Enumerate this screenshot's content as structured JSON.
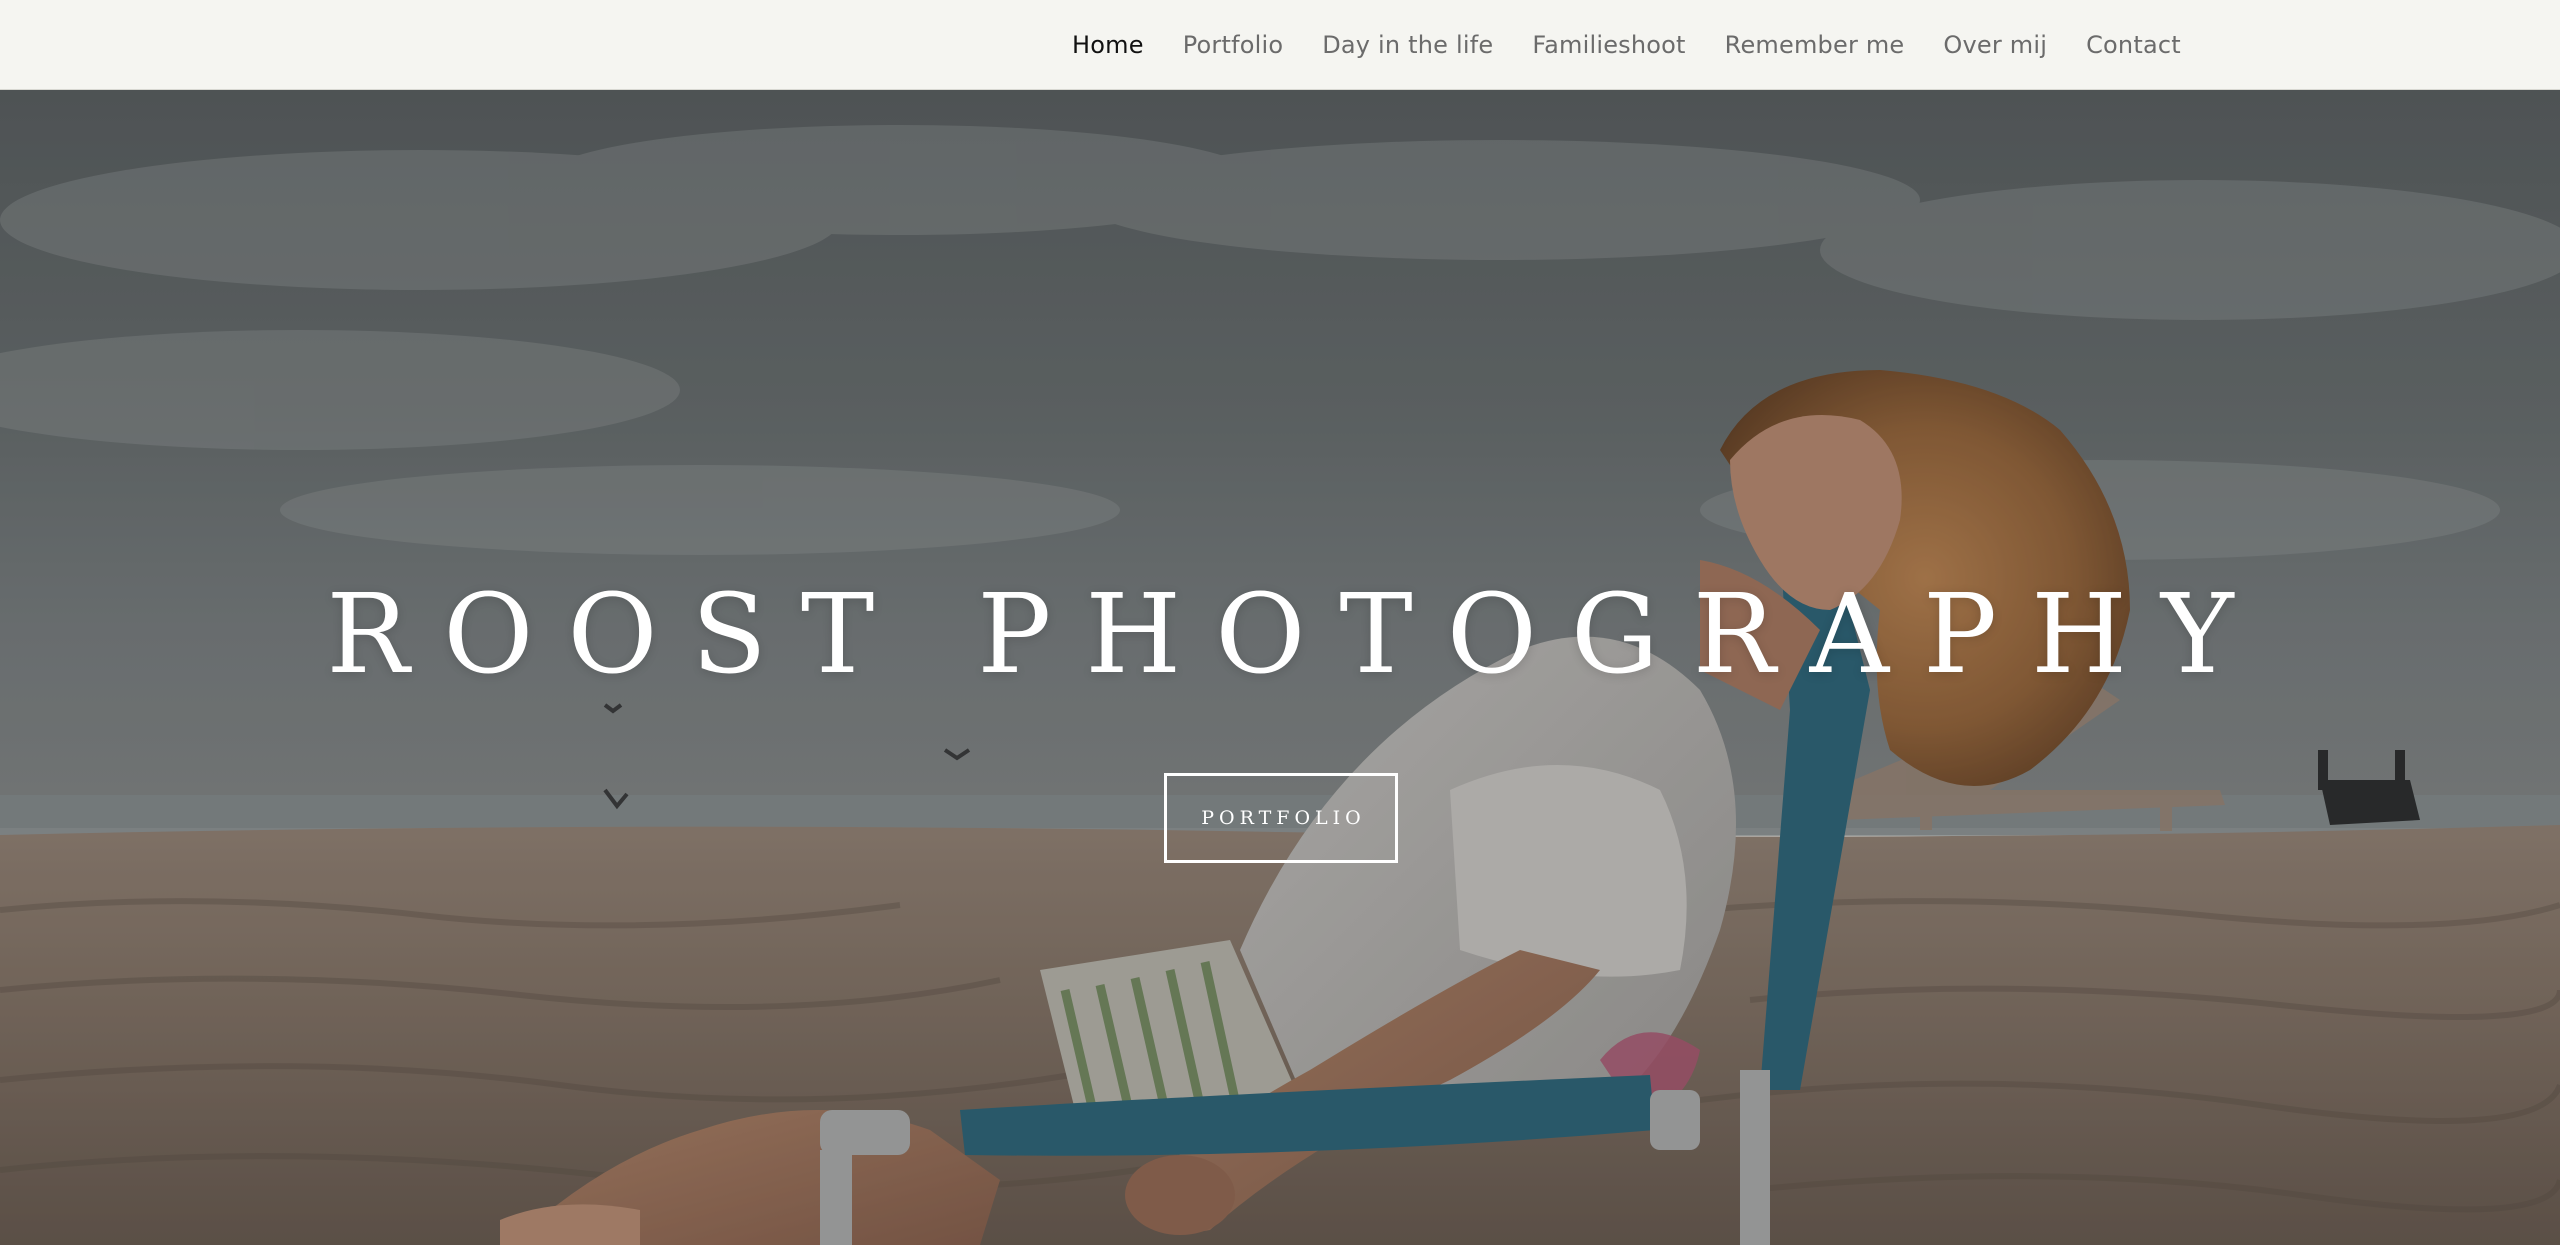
{
  "nav": {
    "items": [
      {
        "label": "Home",
        "active": true
      },
      {
        "label": "Portfolio",
        "active": false
      },
      {
        "label": "Day in the life",
        "active": false
      },
      {
        "label": "Familieshoot",
        "active": false
      },
      {
        "label": "Remember me",
        "active": false
      },
      {
        "label": "Over mij",
        "active": false
      },
      {
        "label": "Contact",
        "active": false
      }
    ]
  },
  "hero": {
    "title": "ROOST PHOTOGRAPHY",
    "button_label": "PORTFOLIO"
  },
  "colors": {
    "header_bg": "#f5f5f1",
    "nav_active": "#111111",
    "nav_inactive": "#6b6b6b",
    "hero_text": "#ffffff"
  }
}
